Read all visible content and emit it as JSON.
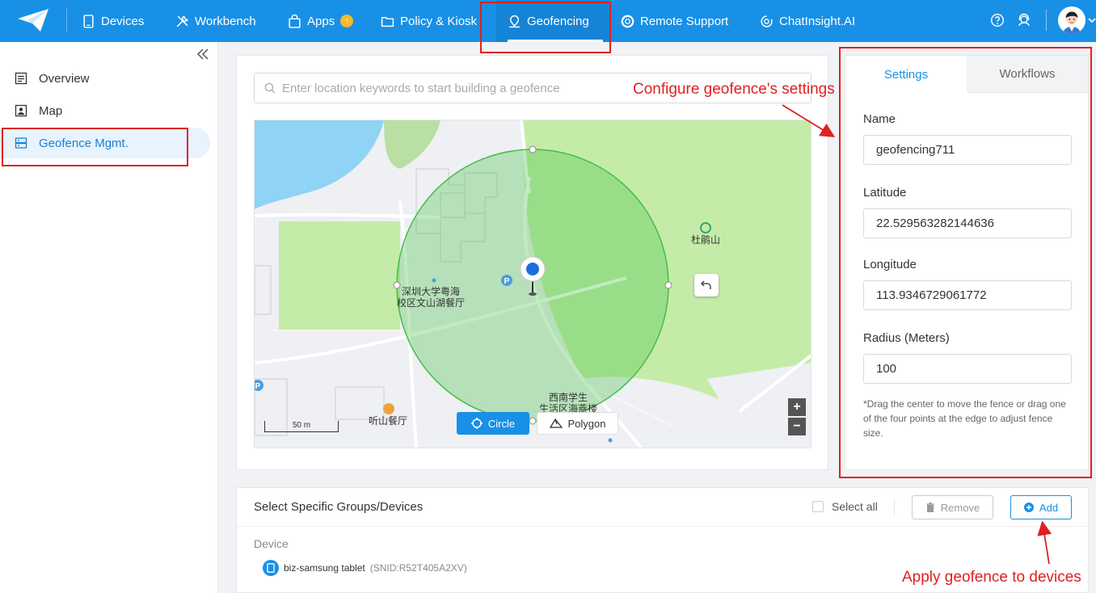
{
  "topnav": {
    "items": [
      {
        "label": "Devices",
        "icon": "tablet-icon"
      },
      {
        "label": "Workbench",
        "icon": "tools-icon"
      },
      {
        "label": "Apps",
        "icon": "bag-icon",
        "badge": "↑"
      },
      {
        "label": "Policy & Kiosk",
        "icon": "folder-icon"
      },
      {
        "label": "Geofencing",
        "icon": "location-pin-icon",
        "active": true
      },
      {
        "label": "Remote Support",
        "icon": "lifebuoy-icon"
      },
      {
        "label": "ChatInsight.AI",
        "icon": "ai-chat-icon"
      }
    ],
    "right_icons": [
      "help-icon",
      "support-agent-icon"
    ],
    "accent": "#1890e6"
  },
  "sidebar": {
    "items": [
      {
        "label": "Overview",
        "icon": "list-icon"
      },
      {
        "label": "Map",
        "icon": "map-person-icon"
      },
      {
        "label": "Geofence Mgmt.",
        "icon": "server-icon",
        "active": true
      }
    ]
  },
  "map": {
    "search_placeholder": "Enter location keywords to start building a geofence",
    "labels": {
      "poi1_line1": "深圳大学粤海",
      "poi1_line2": "校区文山湖餐厅",
      "poi2": "杜鹃山",
      "poi3": "听山餐厅",
      "poi4_line1": "西南学生",
      "poi4_line2": "生活区海燕楼"
    },
    "scale": "50 m",
    "circle_button": "Circle",
    "polygon_button": "Polygon",
    "zoom_in": "+",
    "zoom_out": "−",
    "mode": "circle"
  },
  "settings": {
    "tabs": [
      "Settings",
      "Workflows"
    ],
    "active_tab": "Settings",
    "name_label": "Name",
    "name_value": "geofencing711",
    "latitude_label": "Latitude",
    "latitude_value": "22.529563282144636",
    "longitude_label": "Longitude",
    "longitude_value": "113.9346729061772",
    "radius_label": "Radius (Meters)",
    "radius_value": "100",
    "hint": "*Drag the center to move the fence or drag one of the four points at the edge to adjust fence size."
  },
  "devices": {
    "title": "Select Specific Groups/Devices",
    "select_all": "Select all",
    "remove": "Remove",
    "add": "Add",
    "section": "Device",
    "rows": [
      {
        "name": "biz-samsung tablet",
        "snid": "(SNID:R52T405A2XV)"
      }
    ]
  },
  "annotations": {
    "settings_note": "Configure geofence's settings",
    "devices_note": "Apply geofence to devices",
    "color": "#e02020"
  }
}
